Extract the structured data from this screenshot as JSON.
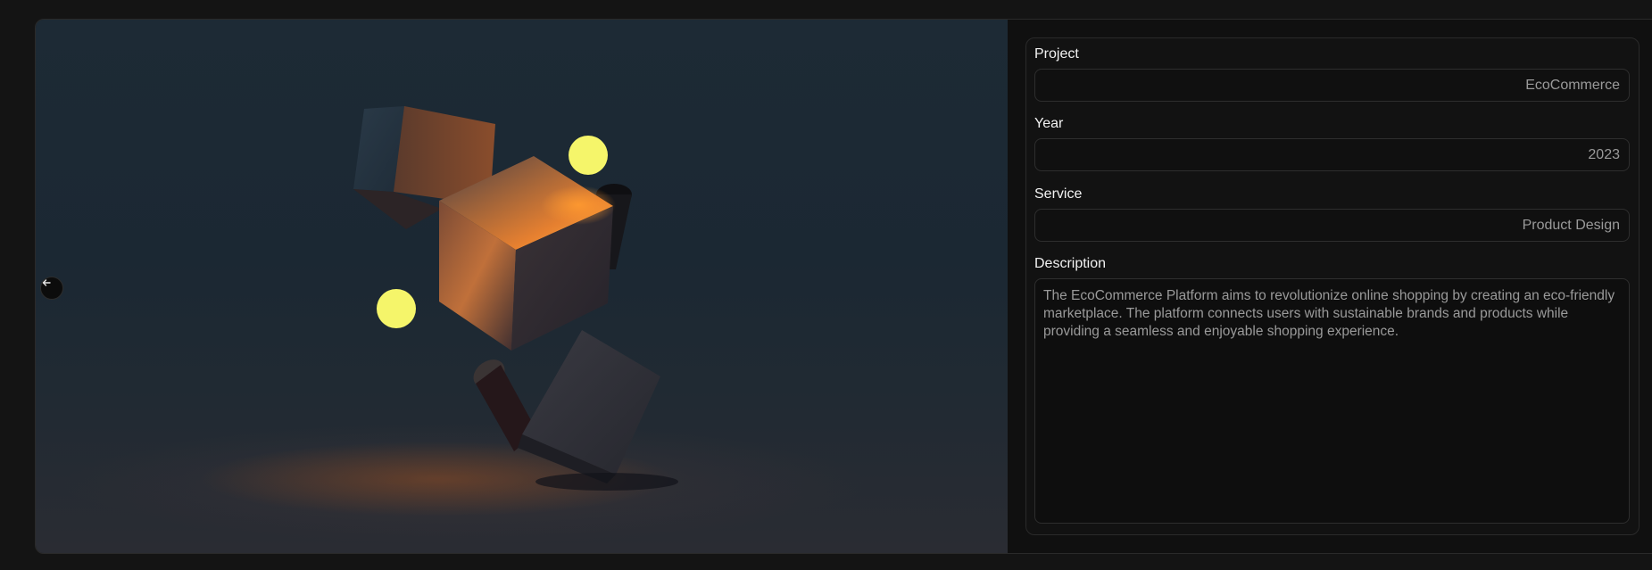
{
  "hero": {
    "image_description_icon": "abstract-cubes-image",
    "back_icon": "arrow-left-icon"
  },
  "details": {
    "project": {
      "label": "Project",
      "value": "EcoCommerce"
    },
    "year": {
      "label": "Year",
      "value": "2023"
    },
    "service": {
      "label": "Service",
      "value": "Product Design"
    },
    "description": {
      "label": "Description",
      "value": "The EcoCommerce Platform aims to revolutionize online shopping by creating an eco-friendly marketplace. The platform connects users with sustainable brands and products while providing a seamless and enjoyable shopping experience."
    }
  },
  "colors": {
    "background": "#141414",
    "panel": "#121212",
    "accent_yellow": "#f5f56a",
    "hero_blue": "#1d2a35"
  }
}
